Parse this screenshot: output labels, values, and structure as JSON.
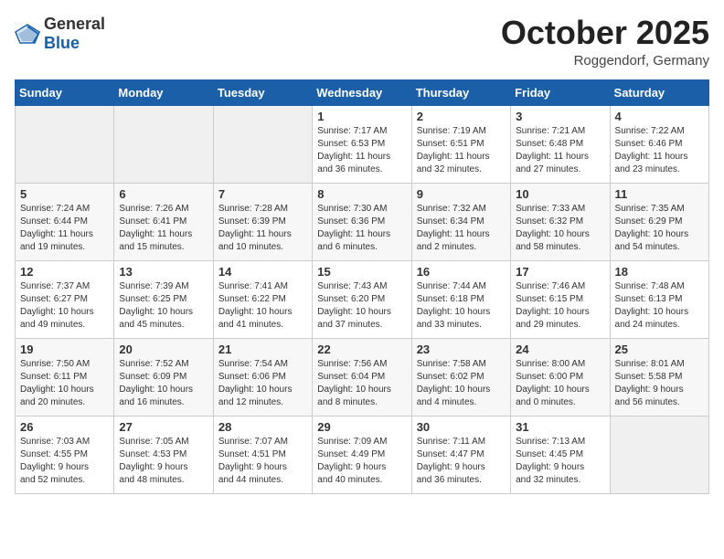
{
  "header": {
    "logo_general": "General",
    "logo_blue": "Blue",
    "month": "October 2025",
    "location": "Roggendorf, Germany"
  },
  "weekdays": [
    "Sunday",
    "Monday",
    "Tuesday",
    "Wednesday",
    "Thursday",
    "Friday",
    "Saturday"
  ],
  "weeks": [
    [
      {
        "day": "",
        "info": ""
      },
      {
        "day": "",
        "info": ""
      },
      {
        "day": "",
        "info": ""
      },
      {
        "day": "1",
        "info": "Sunrise: 7:17 AM\nSunset: 6:53 PM\nDaylight: 11 hours\nand 36 minutes."
      },
      {
        "day": "2",
        "info": "Sunrise: 7:19 AM\nSunset: 6:51 PM\nDaylight: 11 hours\nand 32 minutes."
      },
      {
        "day": "3",
        "info": "Sunrise: 7:21 AM\nSunset: 6:48 PM\nDaylight: 11 hours\nand 27 minutes."
      },
      {
        "day": "4",
        "info": "Sunrise: 7:22 AM\nSunset: 6:46 PM\nDaylight: 11 hours\nand 23 minutes."
      }
    ],
    [
      {
        "day": "5",
        "info": "Sunrise: 7:24 AM\nSunset: 6:44 PM\nDaylight: 11 hours\nand 19 minutes."
      },
      {
        "day": "6",
        "info": "Sunrise: 7:26 AM\nSunset: 6:41 PM\nDaylight: 11 hours\nand 15 minutes."
      },
      {
        "day": "7",
        "info": "Sunrise: 7:28 AM\nSunset: 6:39 PM\nDaylight: 11 hours\nand 10 minutes."
      },
      {
        "day": "8",
        "info": "Sunrise: 7:30 AM\nSunset: 6:36 PM\nDaylight: 11 hours\nand 6 minutes."
      },
      {
        "day": "9",
        "info": "Sunrise: 7:32 AM\nSunset: 6:34 PM\nDaylight: 11 hours\nand 2 minutes."
      },
      {
        "day": "10",
        "info": "Sunrise: 7:33 AM\nSunset: 6:32 PM\nDaylight: 10 hours\nand 58 minutes."
      },
      {
        "day": "11",
        "info": "Sunrise: 7:35 AM\nSunset: 6:29 PM\nDaylight: 10 hours\nand 54 minutes."
      }
    ],
    [
      {
        "day": "12",
        "info": "Sunrise: 7:37 AM\nSunset: 6:27 PM\nDaylight: 10 hours\nand 49 minutes."
      },
      {
        "day": "13",
        "info": "Sunrise: 7:39 AM\nSunset: 6:25 PM\nDaylight: 10 hours\nand 45 minutes."
      },
      {
        "day": "14",
        "info": "Sunrise: 7:41 AM\nSunset: 6:22 PM\nDaylight: 10 hours\nand 41 minutes."
      },
      {
        "day": "15",
        "info": "Sunrise: 7:43 AM\nSunset: 6:20 PM\nDaylight: 10 hours\nand 37 minutes."
      },
      {
        "day": "16",
        "info": "Sunrise: 7:44 AM\nSunset: 6:18 PM\nDaylight: 10 hours\nand 33 minutes."
      },
      {
        "day": "17",
        "info": "Sunrise: 7:46 AM\nSunset: 6:15 PM\nDaylight: 10 hours\nand 29 minutes."
      },
      {
        "day": "18",
        "info": "Sunrise: 7:48 AM\nSunset: 6:13 PM\nDaylight: 10 hours\nand 24 minutes."
      }
    ],
    [
      {
        "day": "19",
        "info": "Sunrise: 7:50 AM\nSunset: 6:11 PM\nDaylight: 10 hours\nand 20 minutes."
      },
      {
        "day": "20",
        "info": "Sunrise: 7:52 AM\nSunset: 6:09 PM\nDaylight: 10 hours\nand 16 minutes."
      },
      {
        "day": "21",
        "info": "Sunrise: 7:54 AM\nSunset: 6:06 PM\nDaylight: 10 hours\nand 12 minutes."
      },
      {
        "day": "22",
        "info": "Sunrise: 7:56 AM\nSunset: 6:04 PM\nDaylight: 10 hours\nand 8 minutes."
      },
      {
        "day": "23",
        "info": "Sunrise: 7:58 AM\nSunset: 6:02 PM\nDaylight: 10 hours\nand 4 minutes."
      },
      {
        "day": "24",
        "info": "Sunrise: 8:00 AM\nSunset: 6:00 PM\nDaylight: 10 hours\nand 0 minutes."
      },
      {
        "day": "25",
        "info": "Sunrise: 8:01 AM\nSunset: 5:58 PM\nDaylight: 9 hours\nand 56 minutes."
      }
    ],
    [
      {
        "day": "26",
        "info": "Sunrise: 7:03 AM\nSunset: 4:55 PM\nDaylight: 9 hours\nand 52 minutes."
      },
      {
        "day": "27",
        "info": "Sunrise: 7:05 AM\nSunset: 4:53 PM\nDaylight: 9 hours\nand 48 minutes."
      },
      {
        "day": "28",
        "info": "Sunrise: 7:07 AM\nSunset: 4:51 PM\nDaylight: 9 hours\nand 44 minutes."
      },
      {
        "day": "29",
        "info": "Sunrise: 7:09 AM\nSunset: 4:49 PM\nDaylight: 9 hours\nand 40 minutes."
      },
      {
        "day": "30",
        "info": "Sunrise: 7:11 AM\nSunset: 4:47 PM\nDaylight: 9 hours\nand 36 minutes."
      },
      {
        "day": "31",
        "info": "Sunrise: 7:13 AM\nSunset: 4:45 PM\nDaylight: 9 hours\nand 32 minutes."
      },
      {
        "day": "",
        "info": ""
      }
    ]
  ]
}
